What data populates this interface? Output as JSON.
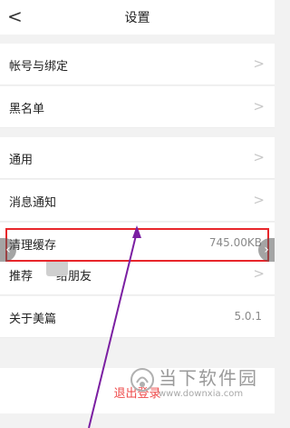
{
  "header": {
    "back_glyph": "<",
    "title": "设置"
  },
  "groups": {
    "account": [
      {
        "label": "帐号与绑定"
      },
      {
        "label": "黑名单"
      }
    ],
    "general": [
      {
        "label": "通用"
      },
      {
        "label": "消息通知"
      },
      {
        "label": "清理缓存",
        "value": "745.00KB"
      },
      {
        "label_prefix": "推荐",
        "label_suffix": "给朋友"
      },
      {
        "label": "关于美篇",
        "value": "5.0.1"
      }
    ]
  },
  "logout": {
    "label": "退出登录"
  },
  "watermark": {
    "text": "当下软件园",
    "url": "www.downxia.com"
  },
  "chevron_glyph": ">",
  "nav_left_glyph": "‹",
  "nav_right_glyph": "›",
  "colors": {
    "highlight": "#e8262b",
    "arrow": "#7b1fa2",
    "logout_text": "#ee4a4a"
  }
}
